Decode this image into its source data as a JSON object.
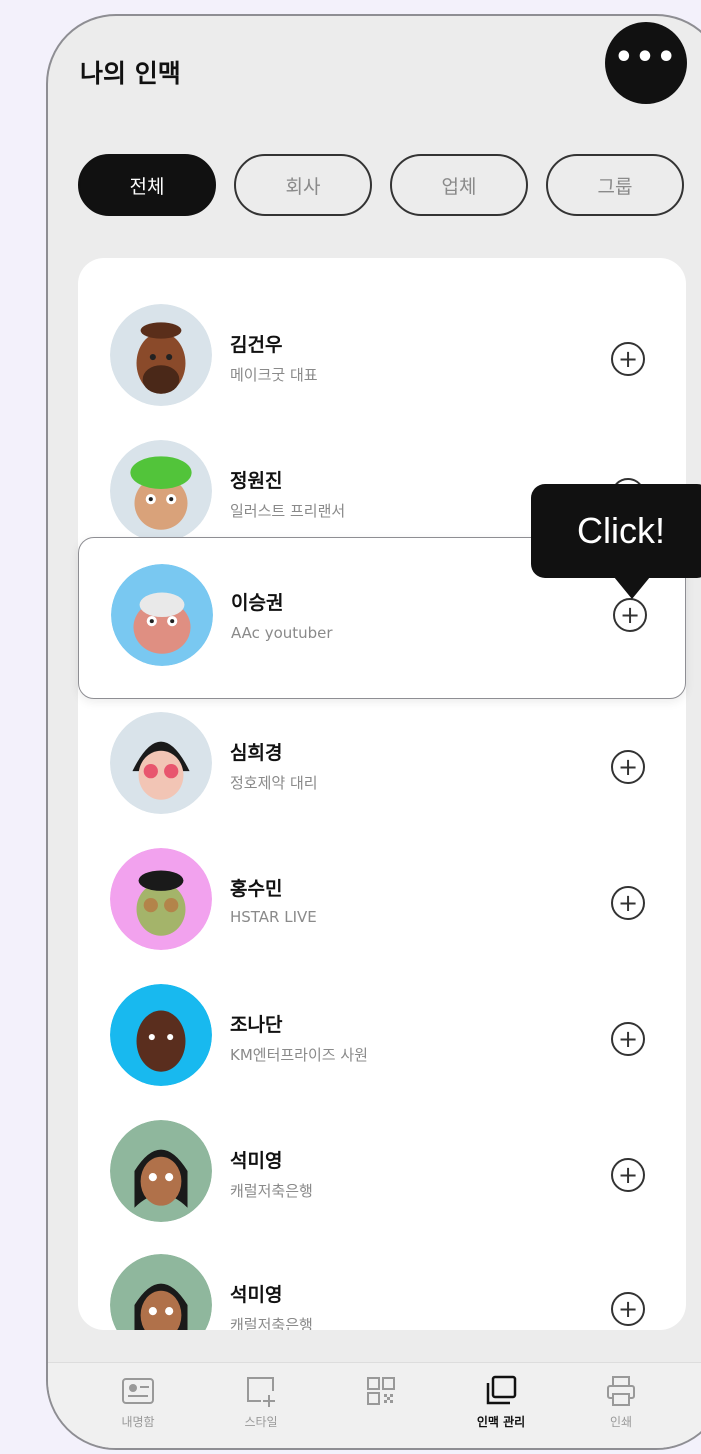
{
  "header": {
    "title": "나의 인맥",
    "more_label": "•••"
  },
  "tabs": [
    {
      "label": "전체",
      "active": true
    },
    {
      "label": "회사",
      "active": false
    },
    {
      "label": "업체",
      "active": false
    },
    {
      "label": "그룹",
      "active": false
    }
  ],
  "contacts": [
    {
      "name": "김건우",
      "subtitle": "메이크굿 대표",
      "avatar_color": "#d9e3ea"
    },
    {
      "name": "정원진",
      "subtitle": "일러스트 프리랜서",
      "avatar_color": "#d9e3ea"
    },
    {
      "name": "이승권",
      "subtitle": "AAc youtuber",
      "avatar_color": "#79c8f1"
    },
    {
      "name": "심희경",
      "subtitle": "정호제약 대리",
      "avatar_color": "#d9e3ea"
    },
    {
      "name": "홍수민",
      "subtitle": "HSTAR LIVE",
      "avatar_color": "#f2a2ee"
    },
    {
      "name": "조나단",
      "subtitle": "KM엔터프라이즈 사원",
      "avatar_color": "#18b9ef"
    },
    {
      "name": "석미영",
      "subtitle": "캐럴저축은행",
      "avatar_color": "#8fb79d"
    },
    {
      "name": "석미영",
      "subtitle": "캐럴저축은행",
      "avatar_color": "#8fb79d"
    }
  ],
  "add_icon_glyph": "+",
  "tooltip": {
    "text": "Click!"
  },
  "bottom_nav": [
    {
      "label": "내명함",
      "icon": "id-card-icon",
      "active": false
    },
    {
      "label": "스타일",
      "icon": "add-frame-icon",
      "active": false
    },
    {
      "label": "",
      "icon": "qr-code-icon",
      "active": false
    },
    {
      "label": "인맥 관리",
      "icon": "stacked-cards-icon",
      "active": true
    },
    {
      "label": "인쇄",
      "icon": "printer-icon",
      "active": false
    }
  ]
}
